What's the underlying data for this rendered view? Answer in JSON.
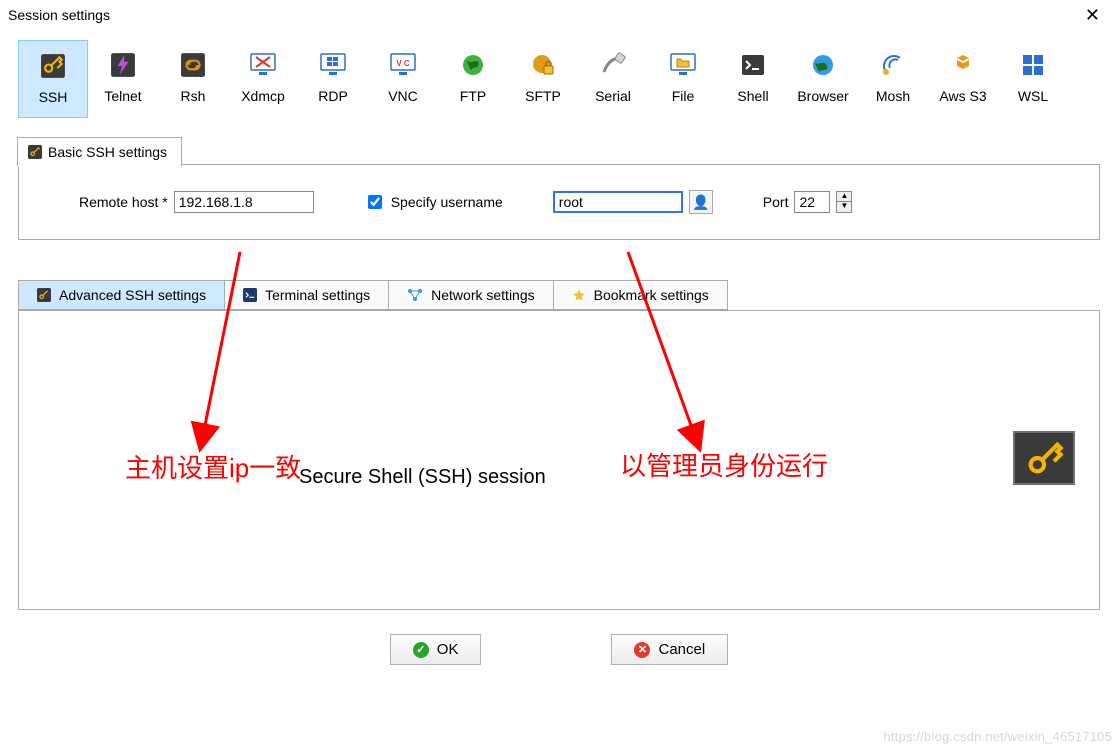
{
  "window": {
    "title": "Session settings"
  },
  "types": [
    {
      "id": "ssh",
      "label": "SSH",
      "selected": true
    },
    {
      "id": "telnet",
      "label": "Telnet"
    },
    {
      "id": "rsh",
      "label": "Rsh"
    },
    {
      "id": "xdmcp",
      "label": "Xdmcp"
    },
    {
      "id": "rdp",
      "label": "RDP"
    },
    {
      "id": "vnc",
      "label": "VNC"
    },
    {
      "id": "ftp",
      "label": "FTP"
    },
    {
      "id": "sftp",
      "label": "SFTP"
    },
    {
      "id": "serial",
      "label": "Serial"
    },
    {
      "id": "file",
      "label": "File"
    },
    {
      "id": "shell",
      "label": "Shell"
    },
    {
      "id": "browser",
      "label": "Browser"
    },
    {
      "id": "mosh",
      "label": "Mosh"
    },
    {
      "id": "awss3",
      "label": "Aws S3"
    },
    {
      "id": "wsl",
      "label": "WSL"
    }
  ],
  "basic_tab_label": "Basic SSH settings",
  "fields": {
    "remote_host_label": "Remote host *",
    "remote_host_value": "192.168.1.8",
    "specify_username_label": "Specify username",
    "specify_username_checked": true,
    "username_value": "root",
    "port_label": "Port",
    "port_value": "22"
  },
  "subtabs": {
    "advanced": "Advanced SSH settings",
    "terminal": "Terminal settings",
    "network": "Network settings",
    "bookmark": "Bookmark settings"
  },
  "panel": {
    "session_title": "Secure Shell (SSH) session"
  },
  "annotations": {
    "left": "主机设置ip一致",
    "right": "以管理员身份运行"
  },
  "buttons": {
    "ok": "OK",
    "cancel": "Cancel"
  },
  "watermark": "https://blog.csdn.net/weixin_46517105"
}
